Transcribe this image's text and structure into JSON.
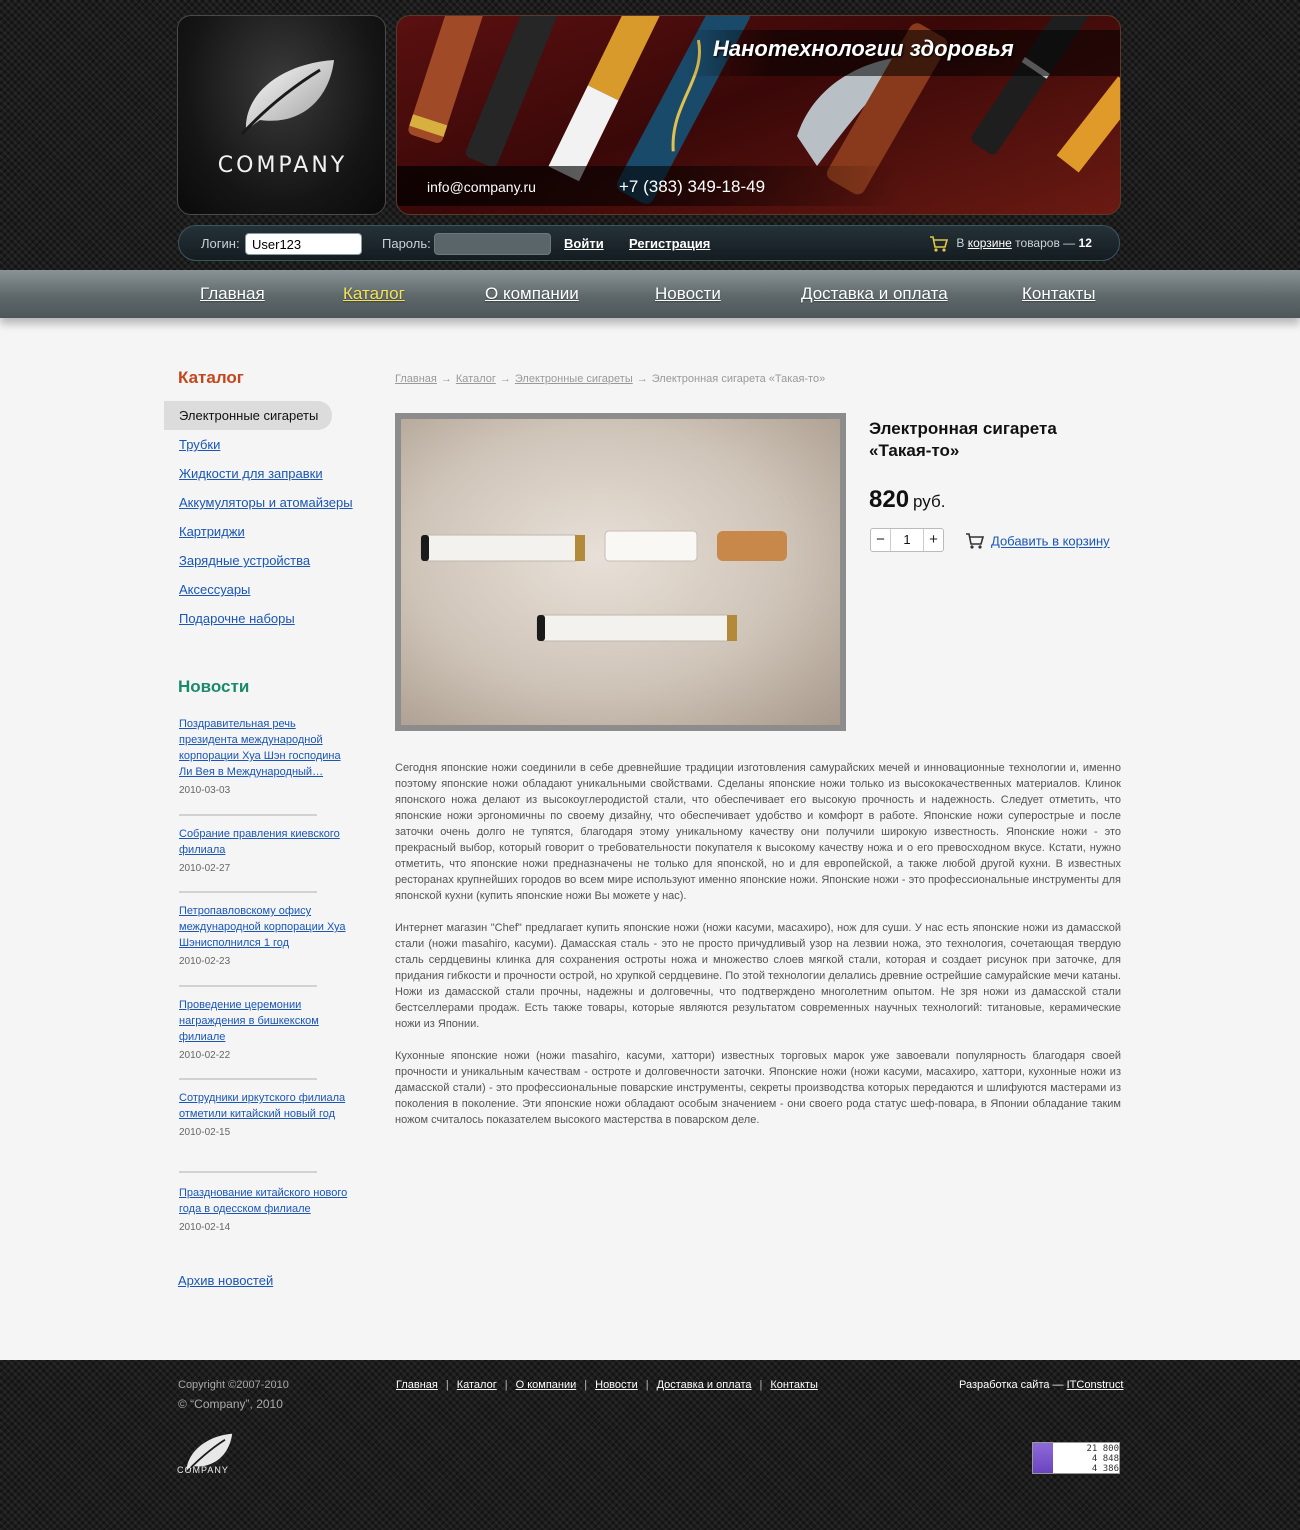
{
  "brand": {
    "logo_text": "COMPANY"
  },
  "banner": {
    "title": "Нанотехнологии здоровья",
    "email": "info@company.ru",
    "phone": "+7 (383) 349-18-49"
  },
  "login": {
    "login_label": "Логин:",
    "login_value": "User123",
    "password_label": "Пароль:",
    "enter": "Войти",
    "register": "Регистрация",
    "cart_prefix": "В",
    "cart_link": "корзине",
    "cart_mid": "товаров —",
    "cart_count": "12"
  },
  "nav": [
    {
      "label": "Главная"
    },
    {
      "label": "Каталог"
    },
    {
      "label": "О компании"
    },
    {
      "label": "Новости"
    },
    {
      "label": "Доставка и оплата"
    },
    {
      "label": "Контакты"
    }
  ],
  "sidebar": {
    "catalog_title": "Каталог",
    "catalog": [
      {
        "label": "Электронные сигареты"
      },
      {
        "label": "Трубки"
      },
      {
        "label": "Жидкости для заправки"
      },
      {
        "label": "Аккумуляторы и атомайзеры"
      },
      {
        "label": "Картриджи"
      },
      {
        "label": "Зарядные устройства"
      },
      {
        "label": "Аксессуары"
      },
      {
        "label": "Подарочне наборы"
      }
    ],
    "news_title": "Новости",
    "news": [
      {
        "title": "Поздравительная речь президента международной корпорации Хуа Шэн господина Ли Вея в Международный…",
        "date": "2010-03-03"
      },
      {
        "title": "Собрание правления киевского филиала",
        "date": "2010-02-27"
      },
      {
        "title": "Петропавловскому офису международной корпорации Хуа Шэнисполнился 1 год",
        "date": "2010-02-23"
      },
      {
        "title": "Проведение церемонии награждения в бишкекском филиале",
        "date": "2010-02-22"
      },
      {
        "title": "Сотрудники иркутского филиала отметили китайский новый год",
        "date": "2010-02-15"
      },
      {
        "title": "Празднование китайского нового года в одесском филиале",
        "date": "2010-02-14"
      }
    ],
    "archive": "Архив новостей"
  },
  "breadcrumb": {
    "items": [
      "Главная",
      "Каталог",
      "Электронные сигареты"
    ],
    "current": "Электронная сигарета «Такая-то»"
  },
  "product": {
    "name": "Электронная сигарета «Такая-то»",
    "price": "820",
    "currency": "руб.",
    "quantity": "1",
    "add_to_cart": "Добавить в корзину"
  },
  "description": [
    "Сегодня японские ножи соединили в себе древнейшие традиции изготовления самурайских мечей и инновационные технологии и, именно поэтому японские ножи обладают уникальными свойствами. Сделаны японские ножи только из высококачественных материалов. Клинок японского ножа делают из высокоуглеродистой стали, что обеспечивает его высокую прочность и надежность. Следует отметить, что японские ножи эргономичны по своему дизайну, что обеспечивает удобство и комфорт в работе. Японские ножи суперострые и после заточки очень долго не тупятся, благодаря этому уникальному качеству они получили широкую известность. Японские ножи - это прекрасный выбор, который говорит о требовательности покупателя к высокому качеству ножа и о его превосходном вкусе. Кстати, нужно отметить, что японские ножи предназначены не только для японской, но и для европейской, а также любой другой кухни. В известных ресторанах крупнейших городов во всем мире используют именно японские ножи. Японские ножи - это профессиональные инструменты для японской кухни (купить японские ножи Вы можете у нас).",
    "Интернет магазин \"Chef\" предлагает купить японские ножи (ножи касуми, масахиро), нож для суши. У нас есть японские ножи из дамасской стали (ножи masahiro, касуми). Дамасская сталь - это не просто причудливый узор на лезвии ножа, это технология, сочетающая твердую сталь сердцевины клинка для сохранения остроты ножа и множество слоев мягкой стали, которая и создает рисунок при заточке, для придания гибкости и прочности острой, но хрупкой сердцевине. По этой технологии делались древние острейшие самурайские мечи катаны. Ножи из дамасской стали прочны, надежны и долговечны, что подтверждено многолетним опытом. Не зря ножи из дамасской стали бестселлерами продаж. Есть также товары, которые являются результатом современных научных технологий: титановые, керамические ножи из Японии.",
    "Кухонные японские ножи (ножи masahiro, касуми, хаттори) известных торговых марок уже завоевали популярность благодаря своей прочности и уникальным качествам - остроте и долговечности заточки. Японские ножи (ножи касуми, масахиро, хаттори, кухонные ножи из дамасской стали) - это профессиональные поварские инструменты, секреты производства которых передаются и шлифуются мастерами из поколения в поколение. Эти японские ножи обладают особым значением - они своего рода статус шеф-повара, в Японии обладание таким ножом считалось показателем высокого мастерства в поварском деле."
  ],
  "footer": {
    "copyright": "Copyright ©2007-2010",
    "company": "© “Company”, 2010",
    "links": [
      {
        "label": "Главная"
      },
      {
        "label": "Каталог"
      },
      {
        "label": "О компании"
      },
      {
        "label": "Новости"
      },
      {
        "label": "Доставка и оплата"
      },
      {
        "label": "Контакты"
      }
    ],
    "dev_prefix": "Разработка сайта —",
    "dev_link": "ITConstruct",
    "logo_text": "COMPANY",
    "counter": [
      "21 800",
      "4 848",
      "4 386"
    ]
  },
  "colors": {
    "catalog_title": "#c4471c",
    "news_title": "#1a8a6a",
    "link": "#1a56b8",
    "nav_active": "#f4e35a"
  }
}
